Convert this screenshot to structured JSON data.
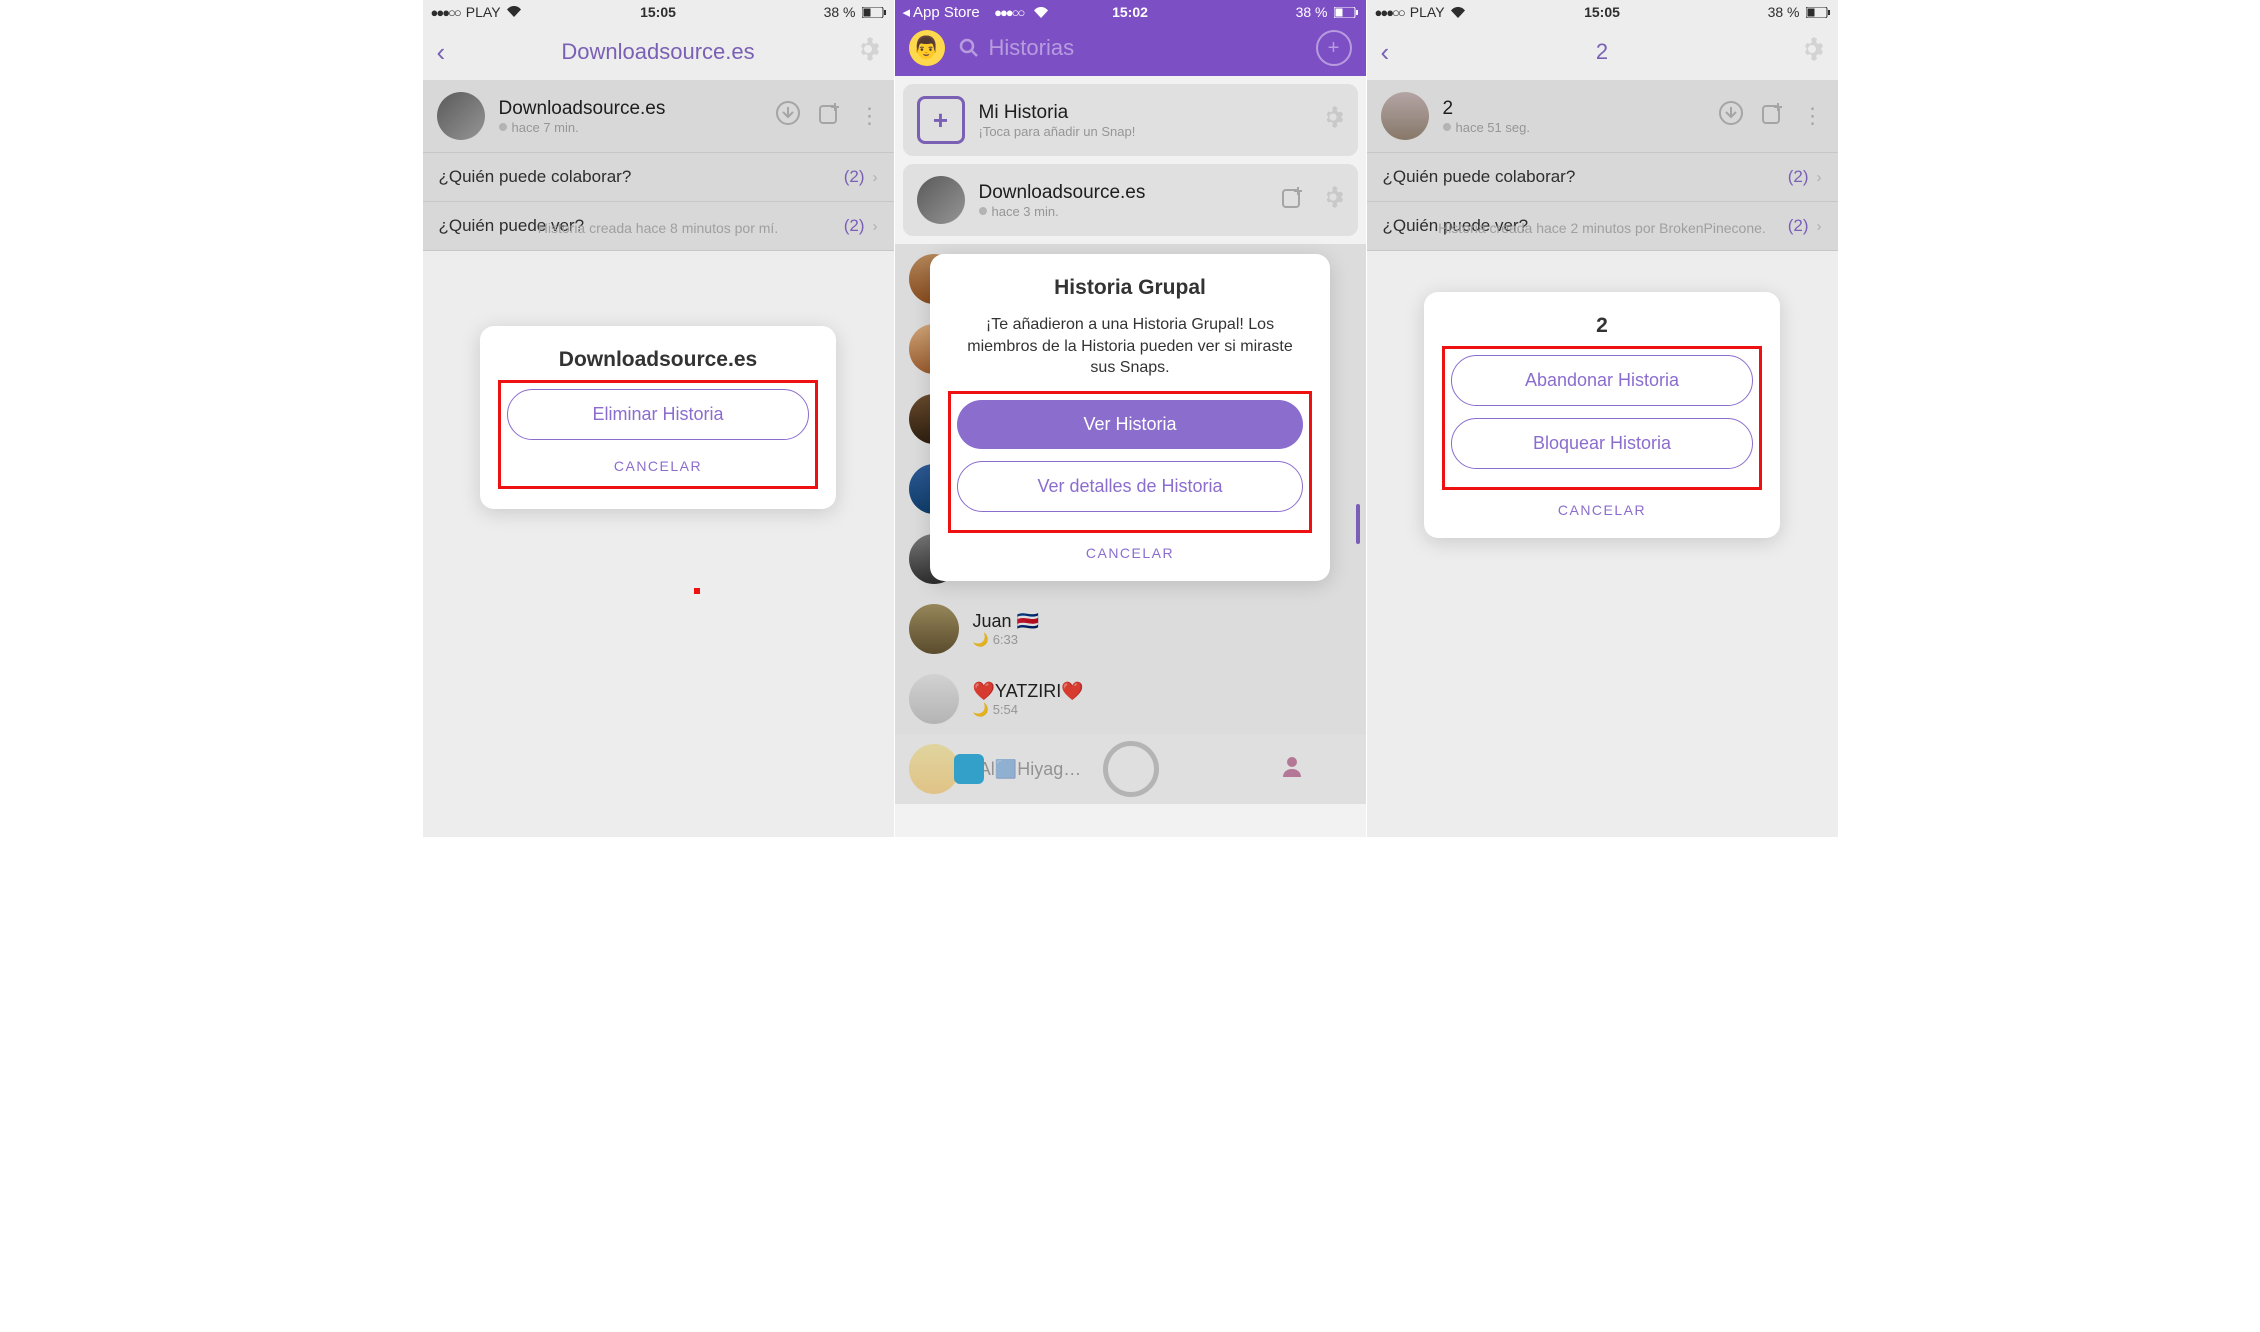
{
  "screens": [
    {
      "status": {
        "carrier": "PLAY",
        "time": "15:05",
        "battery": "38 %",
        "dots": "●●●○○",
        "wifi": "⚑"
      },
      "nav": {
        "title": "Downloadsource.es"
      },
      "story_header": {
        "title": "Downloadsource.es",
        "subtitle": "hace 7 min."
      },
      "rows": [
        {
          "label": "¿Quién puede colaborar?",
          "value": "(2)"
        },
        {
          "label": "¿Quién puede ver?",
          "value": "(2)"
        }
      ],
      "modal": {
        "title": "Downloadsource.es",
        "buttons": [
          {
            "label": "Eliminar Historia"
          }
        ],
        "cancel": "CANCELAR"
      },
      "footer": "Historia creada hace 8 minutos por mí."
    },
    {
      "status": {
        "app_return": "App Store",
        "time": "15:02",
        "battery": "38 %",
        "dots": "●●●○○"
      },
      "search_placeholder": "Historias",
      "my_story": {
        "title": "Mi Historia",
        "subtitle": "¡Toca para añadir un Snap!"
      },
      "dl_story": {
        "title": "Downloadsource.es",
        "subtitle": "hace 3 min."
      },
      "entries": [
        {
          "name": "Juan 🇨🇷",
          "time": "6:33"
        },
        {
          "name": "❤️YATZIRI❤️",
          "time": "5:54"
        },
        {
          "name": "•Al🟦Hiyag…",
          "time": ""
        }
      ],
      "modal": {
        "title": "Historia Grupal",
        "body": "¡Te añadieron a una Historia Grupal! Los miembros de la Historia pueden ver si miraste sus Snaps.",
        "buttons": [
          {
            "label": "Ver Historia",
            "fill": true
          },
          {
            "label": "Ver detalles de Historia"
          }
        ],
        "cancel": "CANCELAR"
      }
    },
    {
      "status": {
        "carrier": "PLAY",
        "time": "15:05",
        "battery": "38 %",
        "dots": "●●●○○"
      },
      "nav": {
        "title": "2"
      },
      "story_header": {
        "title": "2",
        "subtitle": "hace 51 seg."
      },
      "rows": [
        {
          "label": "¿Quién puede colaborar?",
          "value": "(2)"
        },
        {
          "label": "¿Quién puede ver?",
          "value": "(2)"
        }
      ],
      "modal": {
        "title": "2",
        "buttons": [
          {
            "label": "Abandonar Historia"
          },
          {
            "label": "Bloquear Historia"
          }
        ],
        "cancel": "CANCELAR"
      },
      "footer": "Historia creada hace 2 minutos por BrokenPinecone."
    }
  ]
}
